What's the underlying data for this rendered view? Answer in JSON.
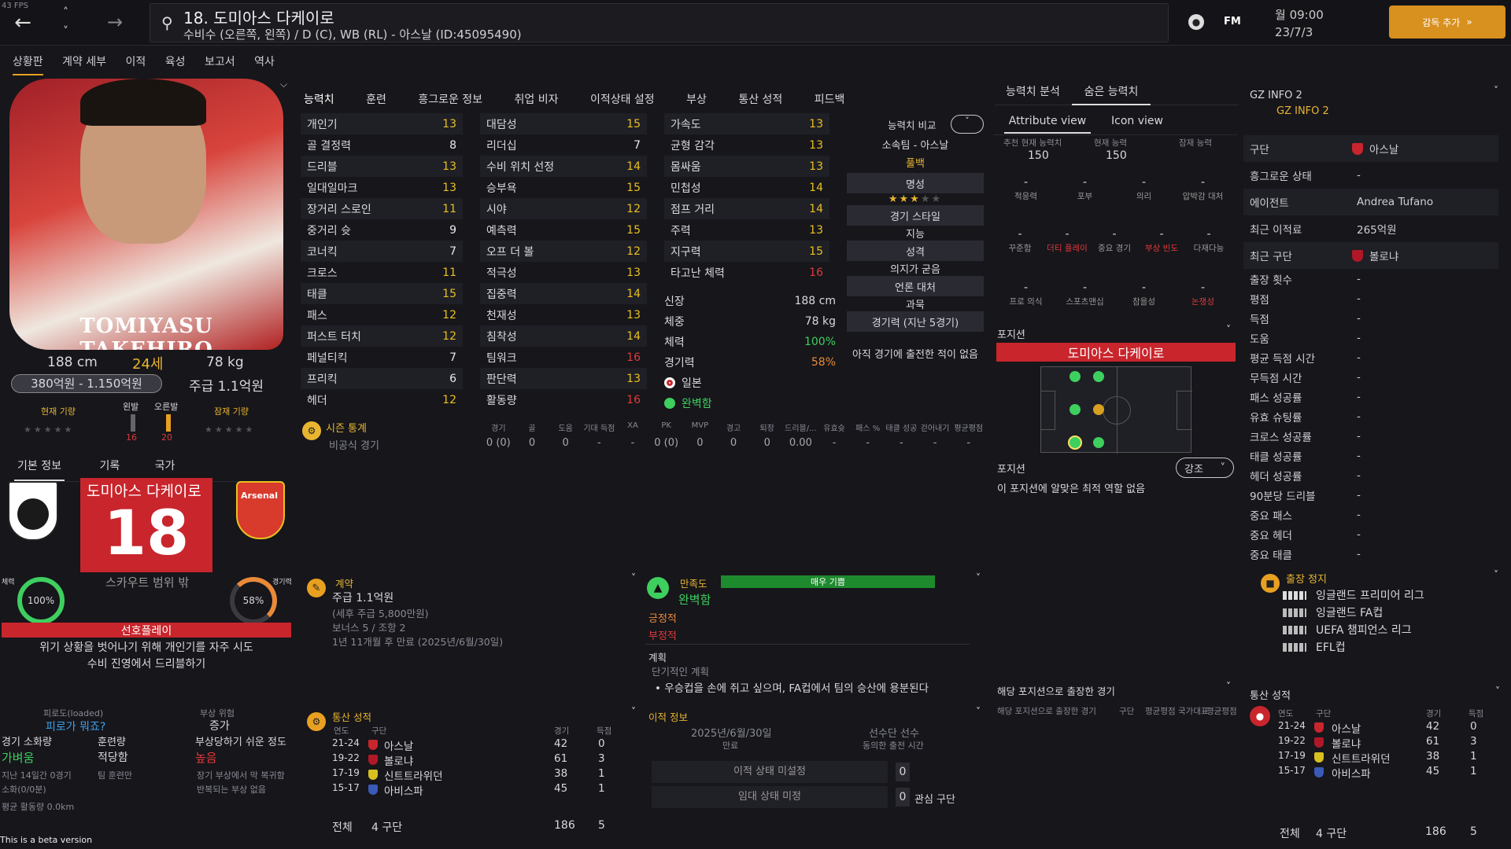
{
  "fps": "43 FPS",
  "player": {
    "title": "18. 도미아스 다케이로",
    "subtitle": "수비수 (오른쪽, 왼쪽) / D (C), WB (RL) - 아스날 (ID:45095490)",
    "name_on_photo": "TOMIYASU TAKEHIRO",
    "height": "188 cm",
    "age": "24세",
    "weight": "78 kg",
    "value": "380억원 - 1.150억원",
    "wage": "주급 1.1억원",
    "number": "18",
    "name_banner": "도미아스 다케이로",
    "scout_status": "스카우트 범위 밖"
  },
  "topbar": {
    "fm": "FM",
    "date_day": "월 09:00",
    "date": "23/7/3",
    "add_btn": "감독 추가"
  },
  "menu": [
    "상황판",
    "계약 세부",
    "이적",
    "육성",
    "보고서",
    "역사"
  ],
  "ability": {
    "current": "현재 기량",
    "potential": "잠재 기량",
    "left_foot": "왼발",
    "right_foot": "오른발",
    "left_val": "16",
    "right_val": "20"
  },
  "left_tabs": [
    "기본 정보",
    "기록",
    "국가"
  ],
  "stats_bars": {
    "fitness_label": "체력",
    "fitness": "100%",
    "match_label": "경기력",
    "match": "58%"
  },
  "preferred": {
    "title": "선호플레이",
    "lines": [
      "위기 상황을 벗어나기 위해 개인기를 자주 시도",
      "수비 진영에서 드리블하기"
    ]
  },
  "bottom_left": {
    "fatigue_label": "피로도(loaded)",
    "fatigue_val": "피로가 뭐죠?",
    "injury_risk_label": "부상 위험",
    "injury_risk_val": "증가",
    "c1_label": "경기 소화량",
    "c1_val": "가벼움",
    "c2_label": "훈련량",
    "c2_val": "적당함",
    "c3_label": "부상당하기 쉬운 정도",
    "c3_val": "높음",
    "n1": "지난 14일간 0경기",
    "n1b": "소화(0/0분)",
    "n2": "팀 훈련만",
    "n3": "장기 부상에서 막 복귀함",
    "n3b": "반복되는 부상 없음",
    "n4": "평균 활동량 0.0km"
  },
  "beta": "This is a beta version",
  "center_tabs": [
    "능력치",
    "훈련",
    "흥그로운 정보",
    "취업 비자",
    "이적상태 설정",
    "부상",
    "통산 성적",
    "피드백"
  ],
  "attrs1": [
    [
      "개인기",
      "13"
    ],
    [
      "골 결정력",
      "8"
    ],
    [
      "드리블",
      "13"
    ],
    [
      "일대일마크",
      "13"
    ],
    [
      "장거리 스로인",
      "11"
    ],
    [
      "중거리 슛",
      "9"
    ],
    [
      "코너킥",
      "7"
    ],
    [
      "크로스",
      "11"
    ],
    [
      "태클",
      "15"
    ],
    [
      "패스",
      "12"
    ],
    [
      "퍼스트 터치",
      "12"
    ],
    [
      "페널티킥",
      "7"
    ],
    [
      "프리킥",
      "6"
    ],
    [
      "헤더",
      "12"
    ]
  ],
  "attrs2": [
    [
      "대담성",
      "15"
    ],
    [
      "리더십",
      "7"
    ],
    [
      "수비 위치 선정",
      "14"
    ],
    [
      "승부욕",
      "15"
    ],
    [
      "시야",
      "12"
    ],
    [
      "예측력",
      "15"
    ],
    [
      "오프 더 볼",
      "12"
    ],
    [
      "적극성",
      "13"
    ],
    [
      "집중력",
      "14"
    ],
    [
      "천재성",
      "13"
    ],
    [
      "침착성",
      "14"
    ],
    [
      "팀워크",
      "16"
    ],
    [
      "판단력",
      "13"
    ],
    [
      "활동량",
      "16"
    ]
  ],
  "attrs3": [
    [
      "가속도",
      "13"
    ],
    [
      "균형 감각",
      "13"
    ],
    [
      "몸싸움",
      "13"
    ],
    [
      "민첩성",
      "14"
    ],
    [
      "점프 거리",
      "14"
    ],
    [
      "주력",
      "13"
    ],
    [
      "지구력",
      "15"
    ],
    [
      "타고난 체력",
      "16"
    ]
  ],
  "phys": [
    [
      "신장",
      "188 cm"
    ],
    [
      "체중",
      "78 kg"
    ],
    [
      "체력",
      "100%"
    ],
    [
      "경기력",
      "58%"
    ],
    [
      "",
      "일본"
    ],
    [
      "",
      "완벽함"
    ]
  ],
  "compare": {
    "label": "능력치 비교",
    "team": "소속팀 - 아스날",
    "rank": "풀백",
    "h1": "명성",
    "h2": "경기 스타일",
    "v2": "지능",
    "h3": "성격",
    "v3": "의지가 굳음",
    "h4": "언론 대처",
    "v4": "과묵",
    "h5": "경기력 (지난 5경기)",
    "v5": "아직 경기에 출전한 적이 없음"
  },
  "season": {
    "title": "시즌 통계",
    "cols": [
      "경기",
      "골",
      "도움",
      "기대 득점",
      "XA",
      "PK",
      "MVP",
      "경고",
      "퇴장",
      "드리블/...",
      "유효슛",
      "패스 %",
      "태클 성공",
      "걷어내기",
      "평균평점"
    ],
    "row_label": "비공식 경기",
    "vals": [
      "0 (0)",
      "0",
      "0",
      "-",
      "-",
      "0 (0)",
      "0",
      "0",
      "0",
      "0.00",
      "-",
      "-",
      "-",
      "-",
      "-"
    ]
  },
  "contract": {
    "title": "계약",
    "wage": "주급 1.1억원",
    "tax": "(세후 주급 5,800만원)",
    "bonus": "보너스 5 / 조항 2",
    "expiry": "1년 11개월 후 만료 (2025년/6월/30일)"
  },
  "happiness": {
    "title": "만족도",
    "bar": "매우 기쁨",
    "state": "완벽함",
    "pos": "긍정적",
    "neg": "부정적",
    "plan_t": "계획",
    "plan_s": "단기적인 계획",
    "plan_1": "우승컵을 손에 쥐고 싶으며, FA컵에서 팀의 승산에 용분된다"
  },
  "career": {
    "title": "통산 성적",
    "h_year": "연도",
    "h_club": "구단",
    "h_apps": "경기",
    "h_goals": "득점",
    "rows": [
      [
        "21-24",
        "아스날",
        "42",
        "0"
      ],
      [
        "19-22",
        "볼로냐",
        "61",
        "3"
      ],
      [
        "17-19",
        "신트트라위던",
        "38",
        "1"
      ],
      [
        "15-17",
        "아비스파",
        "45",
        "1"
      ]
    ],
    "total": "전체",
    "total_clubs": "4 구단",
    "total_apps": "186",
    "total_goals": "5"
  },
  "transfer": {
    "title": "이적 정보",
    "date": "2025년/6월/30일",
    "date_label": "만료",
    "sel": "선수단 선수",
    "sel_sub": "동의한 출전 시간",
    "s1": "이적 상태 미설정",
    "s1v": "0",
    "s2": "임대 상태 미정",
    "s2v": "0",
    "s2l": "관심 구단"
  },
  "right_tabs": [
    "능력치 분석",
    "숨은 능력치"
  ],
  "views": [
    "Attribute view",
    "Icon view"
  ],
  "abil_heads": [
    [
      "추천 현재 능력치",
      "150"
    ],
    [
      "현재 능력",
      "150"
    ],
    [
      "잠재 능력",
      ""
    ]
  ],
  "hidden1": [
    "적응력",
    "포부",
    "의리",
    "압박감 대처"
  ],
  "hidden2": [
    "꾸준함",
    "더티 플레이",
    "중요 경기",
    "부상 빈도",
    "다재다능"
  ],
  "hidden3": [
    "프로 의식",
    "스포츠맨십",
    "참을성",
    "논쟁성"
  ],
  "position": {
    "title": "포지션",
    "name": "도미아스 다케이로",
    "pos_label": "포지션",
    "btn": "강조",
    "note": "이 포지션에 알맞은 최적 역할 없음",
    "played": "해당 포지션으로 출장한 경기",
    "played_cols": [
      "해당 포지션으로 출장한 경기",
      "구단",
      "평균평점",
      "국가대표",
      "평균평점"
    ]
  },
  "gz": {
    "title": "GZ INFO 2",
    "link": "GZ INFO 2",
    "rows": [
      [
        "구단",
        "아스날"
      ],
      [
        "흥그로운 상태",
        "-"
      ],
      [
        "에이전트",
        "Andrea Tufano"
      ],
      [
        "최근 이적료",
        "265억원"
      ],
      [
        "최근 구단",
        "볼로냐"
      ],
      [
        "출장 횟수",
        "-"
      ],
      [
        "평점",
        "-"
      ],
      [
        "득점",
        "-"
      ],
      [
        "도움",
        "-"
      ],
      [
        "평균 득점 시간",
        "-"
      ],
      [
        "무득점 시간",
        "-"
      ],
      [
        "패스 성공률",
        "-"
      ],
      [
        "유효 슈팅률",
        "-"
      ],
      [
        "크로스 성공률",
        "-"
      ],
      [
        "태클 성공률",
        "-"
      ],
      [
        "헤더 성공률",
        "-"
      ],
      [
        "90분당 드리블",
        "-"
      ],
      [
        "중요 패스",
        "-"
      ],
      [
        "중요 헤더",
        "-"
      ],
      [
        "중요 태클",
        "-"
      ]
    ]
  },
  "suspension": {
    "title": "출장 정지",
    "comps": [
      "잉글랜드 프리미어 리그",
      "잉글랜드 FA컵",
      "UEFA 챔피언스 리그",
      "EFL컵"
    ]
  },
  "colors": {
    "accent": "#e8a021",
    "red": "#c9252c",
    "green": "#3ecf5f",
    "bg": "#16161b"
  }
}
